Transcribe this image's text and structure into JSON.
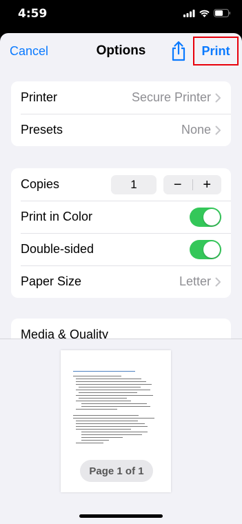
{
  "status_bar": {
    "time": "4:59"
  },
  "nav": {
    "cancel_label": "Cancel",
    "title": "Options",
    "print_label": "Print"
  },
  "printer_group": {
    "rows": [
      {
        "label": "Printer",
        "value": "Secure Printer"
      },
      {
        "label": "Presets",
        "value": "None"
      }
    ]
  },
  "settings_group": {
    "copies_label": "Copies",
    "copies_value": "1",
    "decrement_symbol": "−",
    "increment_symbol": "+",
    "print_in_color_label": "Print in Color",
    "print_in_color_on": true,
    "double_sided_label": "Double-sided",
    "double_sided_on": true,
    "paper_size_label": "Paper Size",
    "paper_size_value": "Letter"
  },
  "media_group": {
    "label": "Media & Quality"
  },
  "preview": {
    "page_indicator": "Page 1 of 1"
  },
  "colors": {
    "accent": "#0a7aff",
    "toggle_on": "#34c759",
    "highlight": "#e8000b"
  }
}
